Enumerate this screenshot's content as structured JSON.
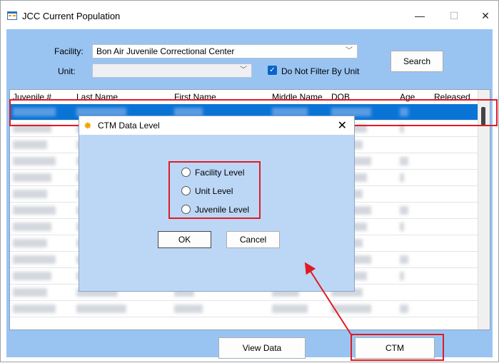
{
  "window": {
    "title": "JCC Current Population"
  },
  "titlebar_buttons": {
    "minimize": "—",
    "maximize": "☐",
    "close": "✕"
  },
  "filters": {
    "facility_label": "Facility:",
    "facility_value": "Bon Air Juvenile Correctional Center",
    "unit_label": "Unit:",
    "unit_value": "",
    "no_filter_label": "Do Not Filter By Unit",
    "no_filter_checked": true,
    "search_button": "Search"
  },
  "grid": {
    "columns": [
      "Juvenile #",
      "Last Name",
      "First Name",
      "Middle Name",
      "DOB",
      "Age",
      "Released"
    ],
    "row_count": 13,
    "selected_row": 0
  },
  "dialog": {
    "title": "CTM Data Level",
    "options": [
      "Facility Level",
      "Unit Level",
      "Juvenile Level"
    ],
    "ok": "OK",
    "cancel": "Cancel",
    "close": "✕",
    "icon": "sun-icon"
  },
  "bottom": {
    "view_data": "View Data",
    "ctm": "CTM"
  },
  "colors": {
    "highlight": "#e01b24",
    "selection": "#0a74d6",
    "form_bg": "#99c4f2"
  }
}
